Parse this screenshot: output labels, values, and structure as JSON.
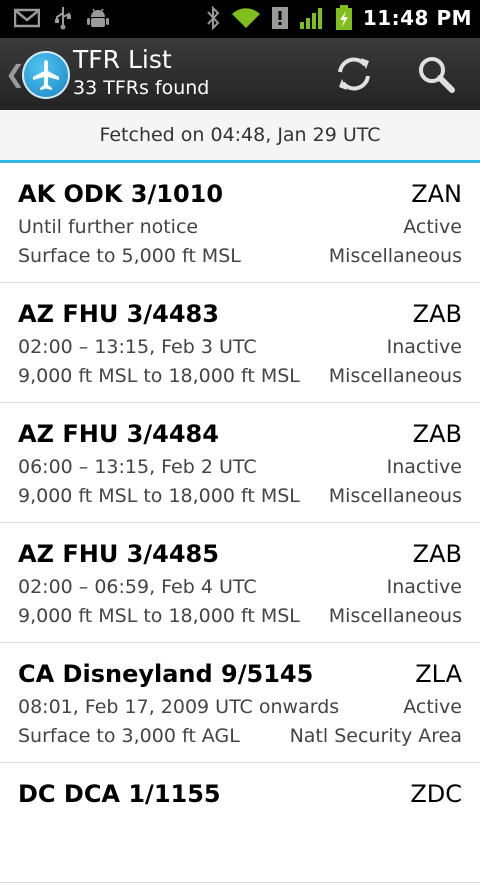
{
  "status_bar": {
    "time": "11:48 PM",
    "icons": [
      "gmail-icon",
      "usb-icon",
      "android-debug-icon",
      "bluetooth-icon",
      "wifi-icon",
      "alert-icon",
      "signal-icon",
      "battery-charging-icon"
    ]
  },
  "action_bar": {
    "title": "TFR List",
    "subtitle": "33 TFRs found",
    "actions": [
      "refresh-icon",
      "search-icon"
    ]
  },
  "fetched": "Fetched on 04:48, Jan 29 UTC",
  "tfrs": [
    {
      "name": "AK ODK 3/1010",
      "center": "ZAN",
      "time": "Until further notice",
      "status": "Active",
      "altitude": "Surface to 5,000 ft MSL",
      "type": "Miscellaneous"
    },
    {
      "name": "AZ FHU 3/4483",
      "center": "ZAB",
      "time": "02:00 – 13:15, Feb 3 UTC",
      "status": "Inactive",
      "altitude": "9,000 ft MSL to 18,000 ft MSL",
      "type": "Miscellaneous"
    },
    {
      "name": "AZ FHU 3/4484",
      "center": "ZAB",
      "time": "06:00 – 13:15, Feb 2 UTC",
      "status": "Inactive",
      "altitude": "9,000 ft MSL to 18,000 ft MSL",
      "type": "Miscellaneous"
    },
    {
      "name": "AZ FHU 3/4485",
      "center": "ZAB",
      "time": "02:00 – 06:59, Feb 4 UTC",
      "status": "Inactive",
      "altitude": "9,000 ft MSL to 18,000 ft MSL",
      "type": "Miscellaneous"
    },
    {
      "name": "CA Disneyland 9/5145",
      "center": "ZLA",
      "time": "08:01, Feb 17, 2009 UTC onwards",
      "status": "Active",
      "altitude": "Surface to 3,000 ft AGL",
      "type": "Natl Security Area"
    },
    {
      "name": "DC DCA 1/1155",
      "center": "ZDC",
      "time": "",
      "status": "",
      "altitude": "",
      "type": ""
    }
  ]
}
